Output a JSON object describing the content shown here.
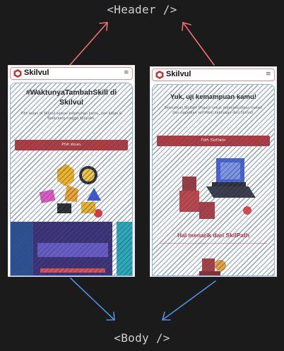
{
  "labels": {
    "header": "<Header />",
    "body": "<Body />"
  },
  "colors": {
    "background": "#1b1b1b",
    "header_outline": "#ef8a8a",
    "body_outline": "#8bb3e6",
    "header_arrow": "#ef7070",
    "body_arrow": "#4f8fe0",
    "brand": "#b83a3a"
  },
  "left_phone": {
    "logo": "Skilvul",
    "menu_icon": "hamburger-icon",
    "title": "#WaktunyaTambahSkill di Skilvul",
    "description": "Pilih kelas di Skilvul sesuai kebutuhan kamu, dari Kelas & Bootcamp hingga Skilpath.",
    "cta": "Pilih Kelas"
  },
  "right_phone": {
    "logo": "Skilvul",
    "menu_icon": "hamburger-icon",
    "title": "Yuk, uji kemampuan kamu!",
    "description": "Selesaikan Skillath Project untuk menyelesaikan materi dan dapatkan sertifikat kelulusan dari Skillvul.",
    "cta": "Pilih SkilPath",
    "section_title": "Hal menarik dari SkilPath"
  }
}
